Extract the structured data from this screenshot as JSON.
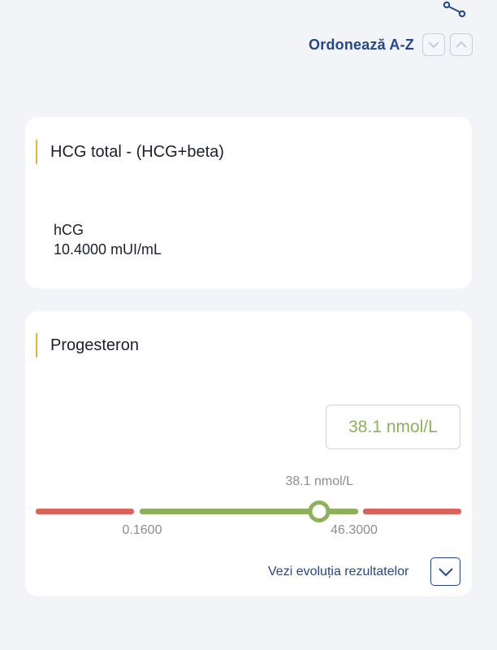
{
  "toolbar": {
    "share_icon": "share-icon",
    "sort_label": "Ordonează A-Z",
    "sort_desc_icon": "chevron-down-icon",
    "sort_asc_icon": "chevron-up-icon"
  },
  "results": [
    {
      "title": "HCG total - (HCG+beta)",
      "param_name": "hCG",
      "param_value": "10.4000 mUI/mL"
    },
    {
      "title": "Progesteron",
      "result_box": "38.1 nmol/L",
      "marker_label": "38.1 nmol/L",
      "range_min": "0.1600",
      "range_max": "46.3000",
      "range_min_value": 0.16,
      "range_max_value": 46.3,
      "value": 38.1,
      "evolution_link": "Vezi evoluția rezultatelor",
      "evolution_icon": "chevron-down-icon",
      "colors": {
        "normal": "#8db15a",
        "out_of_range": "#d9635a"
      }
    }
  ],
  "colors": {
    "accent": "#23478a",
    "title_bar": "#e7b43a",
    "background": "#f2f4f8"
  }
}
